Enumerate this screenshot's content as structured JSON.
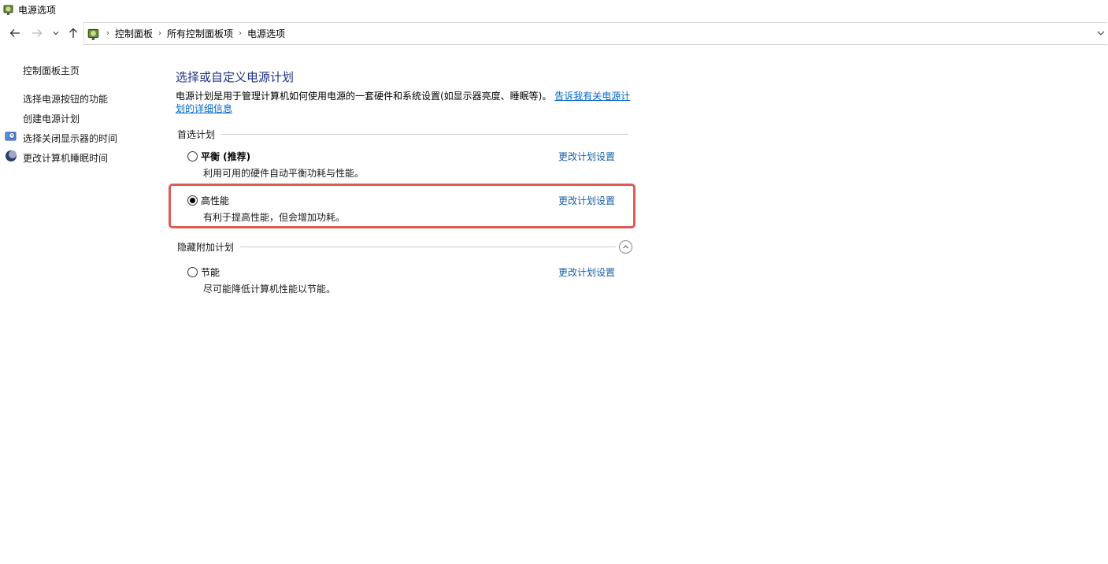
{
  "window": {
    "title": "电源选项"
  },
  "address": {
    "breadcrumbs": [
      "控制面板",
      "所有控制面板项",
      "电源选项"
    ]
  },
  "sidebar": {
    "home": "控制面板主页",
    "items": [
      {
        "label": "选择电源按钮的功能",
        "icon": null
      },
      {
        "label": "创建电源计划",
        "icon": null
      },
      {
        "label": "选择关闭显示器的时间",
        "icon": "display-timer-icon"
      },
      {
        "label": "更改计算机睡眠时间",
        "icon": "sleep-moon-icon"
      }
    ]
  },
  "main": {
    "title": "选择或自定义电源计划",
    "description": "电源计划是用于管理计算机如何使用电源的一套硬件和系统设置(如显示器亮度、睡眠等)。",
    "learn_more_link": "告诉我有关电源计划的详细信息",
    "preferred_group": {
      "label": "首选计划",
      "plans": [
        {
          "name": "平衡 (推荐)",
          "description": "利用可用的硬件自动平衡功耗与性能。",
          "change_link": "更改计划设置",
          "selected": false
        },
        {
          "name": "高性能",
          "description": "有利于提高性能，但会增加功耗。",
          "change_link": "更改计划设置",
          "selected": true
        }
      ]
    },
    "hidden_group": {
      "label": "隐藏附加计划",
      "plans": [
        {
          "name": "节能",
          "description": "尽可能降低计算机性能以节能。",
          "change_link": "更改计划设置",
          "selected": false
        }
      ]
    }
  },
  "colors": {
    "title": "#1e3287",
    "link": "#0066cc",
    "highlight": "#e05a5a"
  }
}
